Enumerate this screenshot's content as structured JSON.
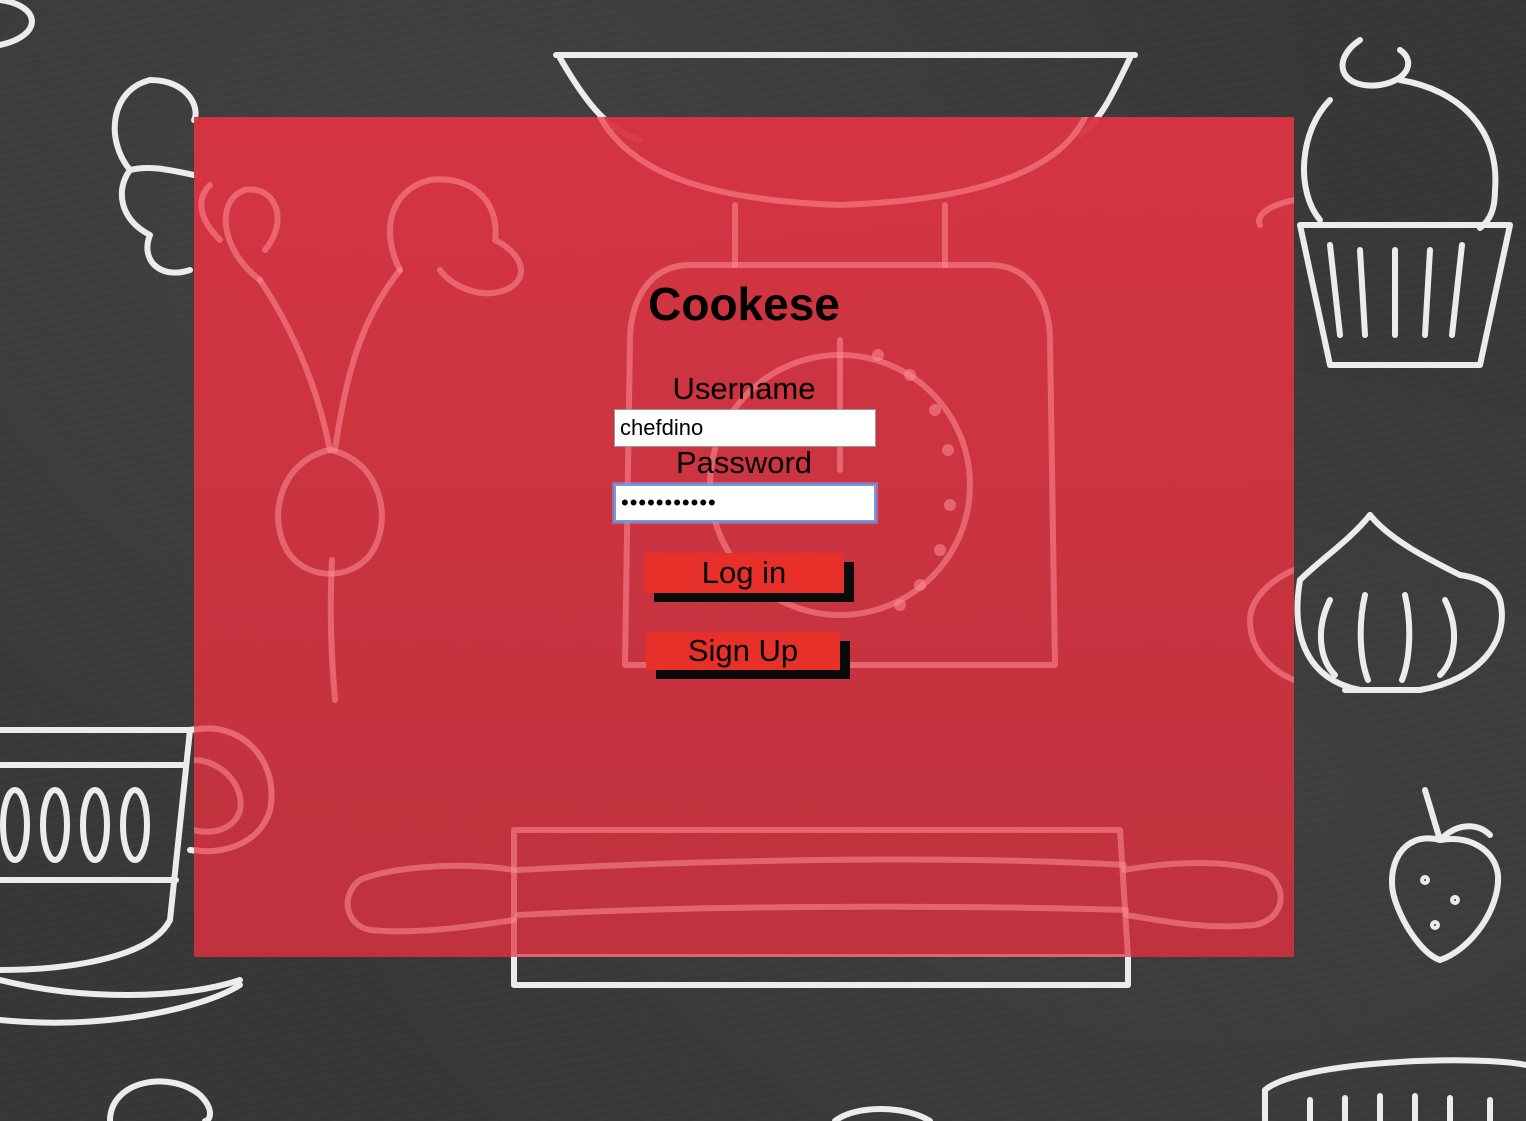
{
  "app": {
    "title": "Cookese"
  },
  "login_form": {
    "username_label": "Username",
    "username_value": "chefdino",
    "password_label": "Password",
    "password_value": "•••••••••••",
    "login_button": "Log in",
    "signup_button": "Sign Up"
  },
  "colors": {
    "background": "#373737",
    "panel": "#d63744",
    "button": "#e8302a",
    "button_shadow": "#0a0a0a",
    "focus_ring": "#6f9be8"
  },
  "background_icons": [
    "bowl-icon",
    "croissant-icon",
    "cupcake-icon",
    "radish-icon",
    "kitchen-scale-icon",
    "teacup-icon",
    "onion-icon",
    "strawberry-icon",
    "rolling-pin-icon"
  ]
}
